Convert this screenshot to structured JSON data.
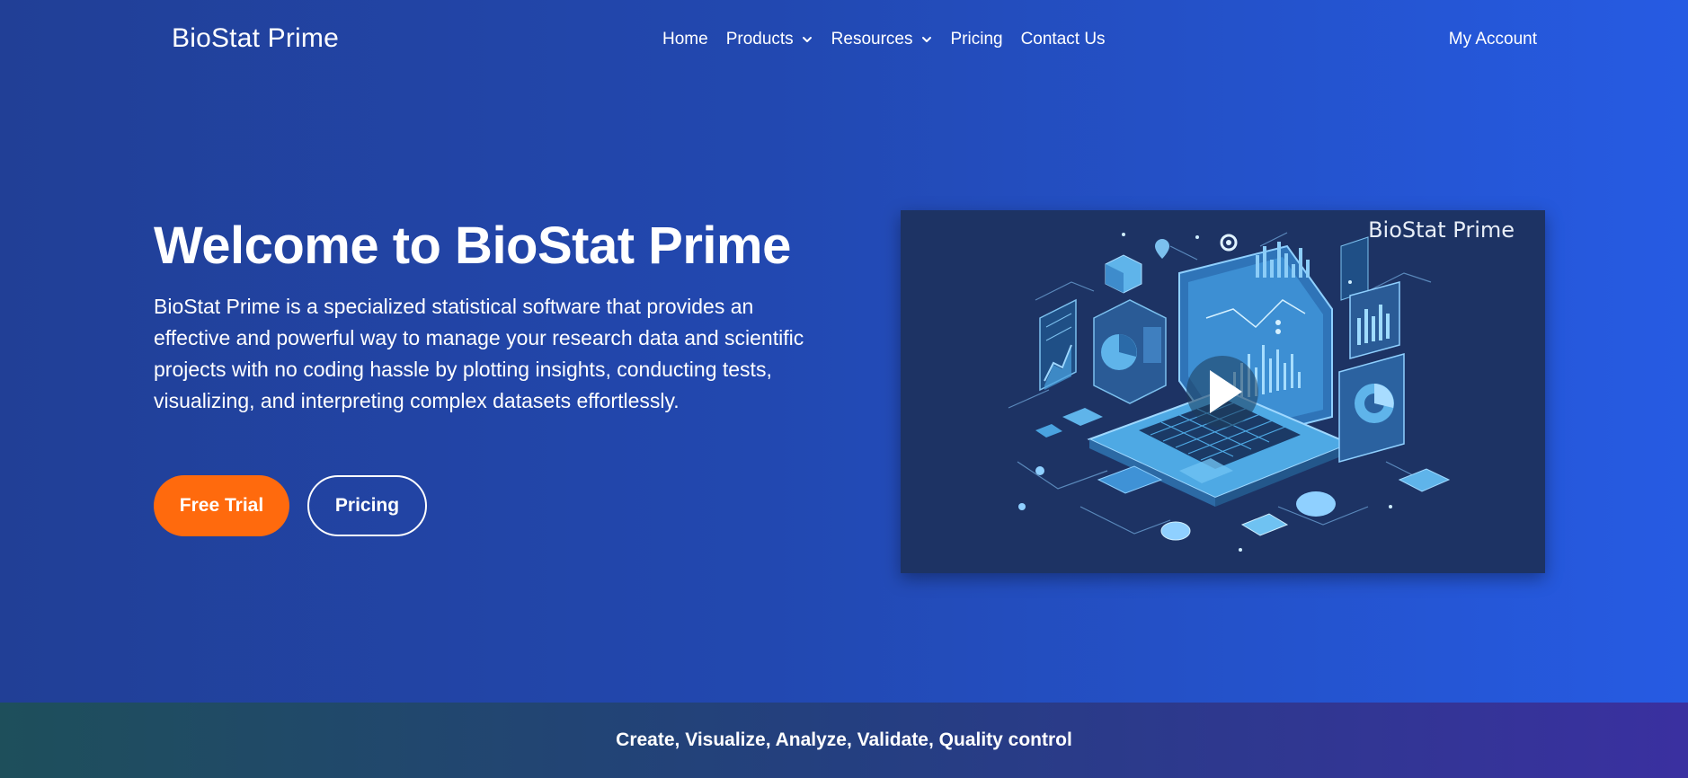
{
  "nav": {
    "brand": "BioStat Prime",
    "items": [
      {
        "label": "Home",
        "has_dropdown": false
      },
      {
        "label": "Products",
        "has_dropdown": true
      },
      {
        "label": "Resources",
        "has_dropdown": true
      },
      {
        "label": "Pricing",
        "has_dropdown": false
      },
      {
        "label": "Contact Us",
        "has_dropdown": false
      }
    ],
    "account_label": "My Account"
  },
  "hero": {
    "title": "Welcome to BioStat Prime",
    "description": "BioStat Prime is a specialized statistical software that provides an effective and powerful way to manage your research data and scientific projects with no coding hassle by plotting insights, conducting tests, visualizing, and interpreting complex datasets effortlessly.",
    "primary_button": "Free Trial",
    "secondary_button": "Pricing"
  },
  "video": {
    "overlay_brand": "BioStat Prime",
    "play_icon": "play-icon"
  },
  "banner": {
    "text": "Create, Visualize, Analyze, Validate, Quality control"
  },
  "colors": {
    "accent_orange": "#ff6a0d",
    "bg_start": "#213f96",
    "bg_end": "#265be3",
    "video_bg": "#1d3364"
  }
}
